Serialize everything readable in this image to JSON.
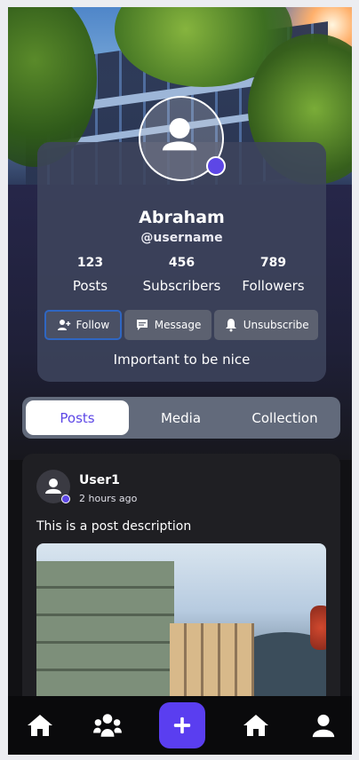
{
  "profile": {
    "name": "Abraham",
    "username": "@username",
    "bio": "Important to be nice",
    "stats": [
      {
        "value": "123",
        "label": "Posts"
      },
      {
        "value": "456",
        "label": "Subscribers"
      },
      {
        "value": "789",
        "label": "Followers"
      }
    ],
    "actions": {
      "follow": "Follow",
      "message": "Message",
      "unsubscribe": "Unsubscribe"
    }
  },
  "tabs": [
    {
      "label": "Posts",
      "active": true
    },
    {
      "label": "Media",
      "active": false
    },
    {
      "label": "Collection",
      "active": false
    }
  ],
  "post": {
    "user": "User1",
    "time": "2 hours ago",
    "description": "This is a post description"
  },
  "nav": {
    "items": [
      "home-icon",
      "group-icon",
      "plus-icon",
      "home-icon",
      "user-icon"
    ]
  },
  "colors": {
    "accent": "#5a3ef0",
    "card": "#3e445c",
    "tab_bar": "#626a7b"
  }
}
